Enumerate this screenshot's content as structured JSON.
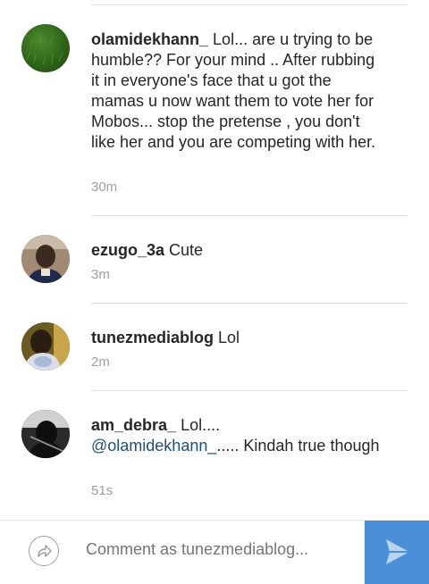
{
  "comments": [
    {
      "username": "olamidekhann_",
      "text": " Lol... are u trying to be humble?? For your mind .. After rubbing it in everyone's face that u got the mamas u now want them to vote her for Mobos... stop the pretense , you don't like her and you are competing with her.",
      "time": "30m"
    },
    {
      "username": "ezugo_3a",
      "text": " Cute",
      "time": "3m"
    },
    {
      "username": "tunezmediablog",
      "text": " Lol",
      "time": "2m"
    },
    {
      "username": "am_debra_",
      "text_before": " Lol....",
      "mention": "@olamidekhann_",
      "text_after": "..... Kindah true though",
      "time": "51s"
    }
  ],
  "composer": {
    "placeholder": "Comment as tunezmediablog...",
    "share_icon": "share-arrow-icon",
    "send_icon": "send-icon",
    "send_color": "#4a90d9"
  }
}
